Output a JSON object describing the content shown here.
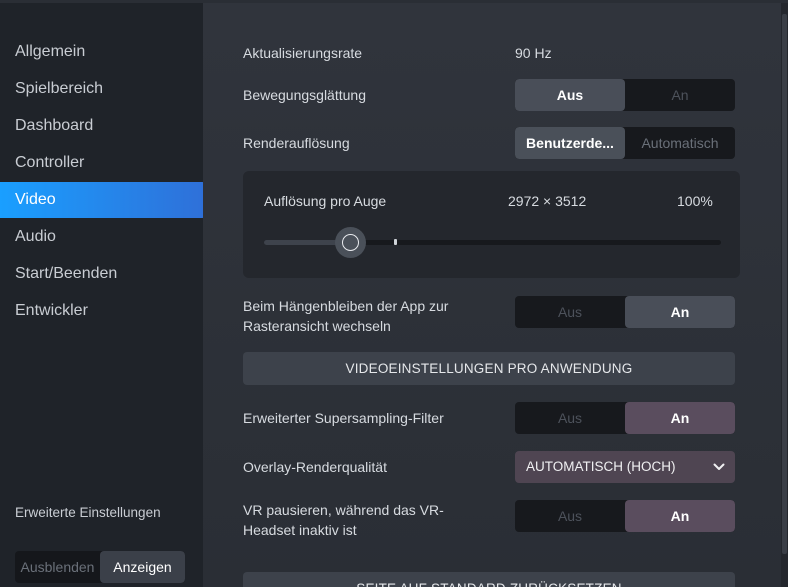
{
  "sidebar": {
    "items": [
      {
        "label": "Allgemein"
      },
      {
        "label": "Spielbereich"
      },
      {
        "label": "Dashboard"
      },
      {
        "label": "Controller"
      },
      {
        "label": "Video",
        "active": true
      },
      {
        "label": "Audio"
      },
      {
        "label": "Start/Beenden"
      },
      {
        "label": "Entwickler"
      }
    ],
    "advanced_label": "Erweiterte Einstellungen",
    "advanced_toggle": {
      "off": "Ausblenden",
      "on": "Anzeigen",
      "selected": "on"
    }
  },
  "settings": {
    "refresh_rate": {
      "label": "Aktualisierungsrate",
      "value": "90 Hz"
    },
    "motion_smoothing": {
      "label": "Bewegungsglättung",
      "off": "Aus",
      "on": "An",
      "selected": "off"
    },
    "render_resolution": {
      "label": "Renderauflösung",
      "custom": "Benutzerde...",
      "auto": "Automatisch",
      "selected": "custom"
    },
    "per_eye": {
      "label": "Auflösung pro Auge",
      "resolution": "2972 × 3512",
      "percent": "100%",
      "slider_fraction": 0.19
    },
    "grid_on_hang": {
      "label": "Beim Hängenbleiben der App zur Rasteransicht wechseln",
      "off": "Aus",
      "on": "An",
      "selected": "on"
    },
    "per_app_button": "VIDEOEINSTELLUNGEN PRO ANWENDUNG",
    "supersampling": {
      "label": "Erweiterter Supersampling-Filter",
      "off": "Aus",
      "on": "An",
      "selected": "on"
    },
    "overlay_quality": {
      "label": "Overlay-Renderqualität",
      "value": "AUTOMATISCH (HOCH)"
    },
    "pause_vr": {
      "label": "VR pausieren, während das VR-Headset inaktiv ist",
      "off": "Aus",
      "on": "An",
      "selected": "on"
    },
    "reset_button": "SEITE AUF STANDARD ZURÜCKSETZEN"
  },
  "colors": {
    "accent_active": "#1a9fff",
    "toggle_on": "#494e58",
    "toggle_on_purple": "#5a4d5e",
    "dropdown_bg": "#4f4552"
  },
  "icons": {
    "dropdown": "chevron-down-icon",
    "slider_knob": "slider-knob"
  }
}
